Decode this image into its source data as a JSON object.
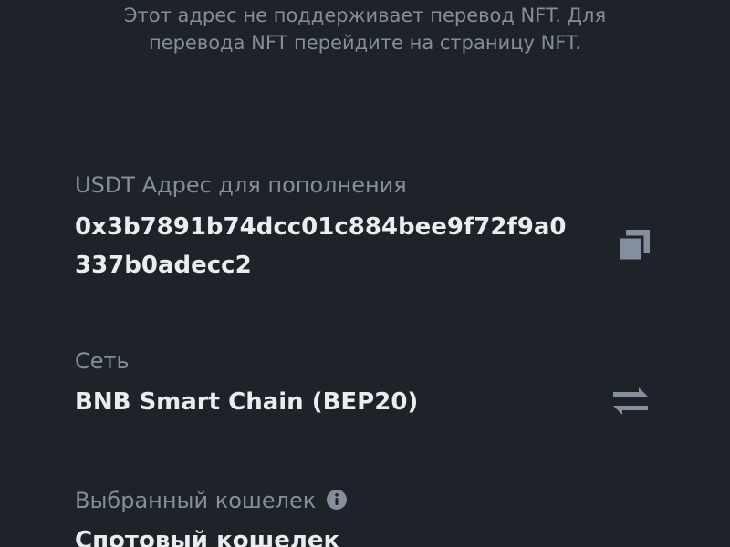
{
  "notice": {
    "line1": "Этот адрес не поддерживает перевод NFT. Для",
    "line2": "перевода NFT перейдите на страницу NFT."
  },
  "address": {
    "label": "USDT Адрес для пополнения",
    "line1": "0x3b7891b74dcc01c884bee9f72f9a0",
    "line2": "337b0adecc2",
    "copy_icon": "copy-icon"
  },
  "network": {
    "label": "Сеть",
    "value": "BNB Smart Chain (BEP20)",
    "switch_icon": "swap-arrows-icon"
  },
  "wallet": {
    "label": "Выбранный кошелек",
    "info_icon": "info-icon",
    "value": "Спотовый кошелек"
  },
  "colors": {
    "background": "#1e2329",
    "primary_text": "#eaecef",
    "secondary_text": "#848e9c",
    "icon": "#848e9c"
  }
}
